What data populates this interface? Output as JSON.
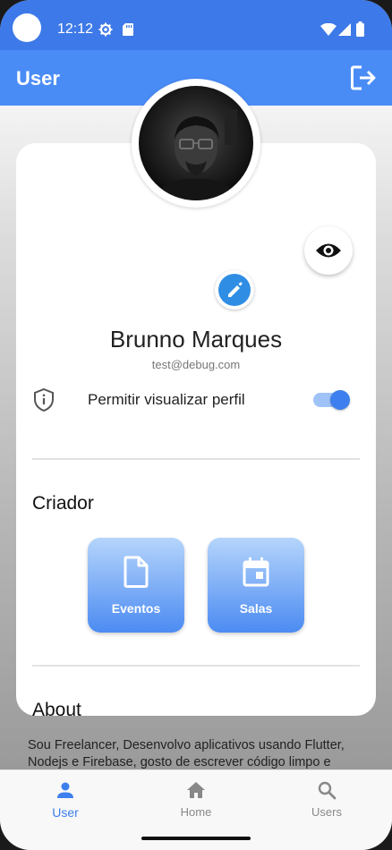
{
  "status_bar": {
    "time": "12:12"
  },
  "app_bar": {
    "title": "User"
  },
  "profile": {
    "name": "Brunno Marques",
    "email": "test@debug.com",
    "permission_label": "Permitir visualizar perfil",
    "permission_enabled": true
  },
  "creator": {
    "title": "Criador",
    "tiles": [
      {
        "label": "Eventos",
        "icon": "document-icon"
      },
      {
        "label": "Salas",
        "icon": "calendar-icon"
      }
    ]
  },
  "about": {
    "title": "About",
    "text": "Sou Freelancer, Desenvolvo aplicativos usando Flutter, Nodejs e Firebase, gosto de escrever código limpo e"
  },
  "bottom_nav": {
    "active": "User",
    "items": [
      {
        "label": "User",
        "icon": "person-icon"
      },
      {
        "label": "Home",
        "icon": "home-icon"
      },
      {
        "label": "Users",
        "icon": "search-icon"
      }
    ]
  },
  "colors": {
    "primary": "#4a8cf6",
    "status_bar": "#3d79e8",
    "accent": "#3d7fee",
    "edit_button": "#2f8de4"
  }
}
